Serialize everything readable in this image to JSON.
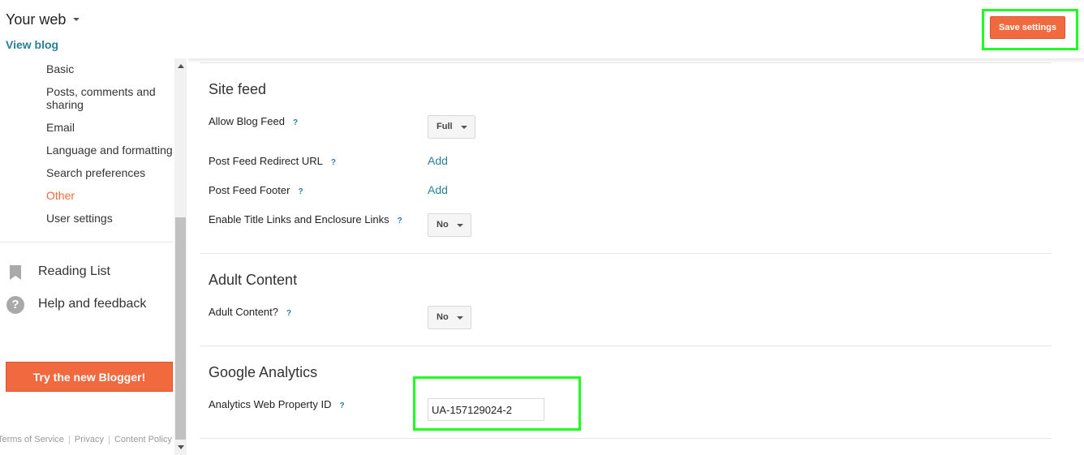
{
  "header": {
    "blog_title": "Your web",
    "view_blog": "View blog",
    "save_button": "Save settings"
  },
  "sidebar": {
    "sub_items": [
      {
        "label": "Basic",
        "active": false
      },
      {
        "label": "Posts, comments and sharing",
        "active": false
      },
      {
        "label": "Email",
        "active": false
      },
      {
        "label": "Language and formatting",
        "active": false
      },
      {
        "label": "Search preferences",
        "active": false
      },
      {
        "label": "Other",
        "active": true
      },
      {
        "label": "User settings",
        "active": false
      }
    ],
    "reading_list": "Reading List",
    "help_feedback": "Help and feedback",
    "try_new_blogger": "Try the new Blogger!",
    "footer": {
      "terms": "Terms of Service",
      "privacy": "Privacy",
      "content_policy": "Content Policy"
    }
  },
  "site_feed": {
    "title": "Site feed",
    "allow_blog_feed": {
      "label": "Allow Blog Feed",
      "help": "?",
      "value": "Full"
    },
    "post_feed_redirect": {
      "label": "Post Feed Redirect URL",
      "help": "?",
      "action": "Add"
    },
    "post_feed_footer": {
      "label": "Post Feed Footer",
      "help": "?",
      "action": "Add"
    },
    "title_links": {
      "label": "Enable Title Links and Enclosure Links",
      "help": "?",
      "value": "No"
    }
  },
  "adult_content": {
    "title": "Adult Content",
    "adult": {
      "label": "Adult Content?",
      "help": "?",
      "value": "No"
    }
  },
  "google_analytics": {
    "title": "Google Analytics",
    "property": {
      "label": "Analytics Web Property ID",
      "help": "?",
      "value": "UA-157129024-2"
    }
  },
  "icons": {
    "help_glyph": "?"
  },
  "colors": {
    "accent": "#f1693f",
    "link": "#2a7e9a",
    "highlight": "#1fff1f"
  }
}
